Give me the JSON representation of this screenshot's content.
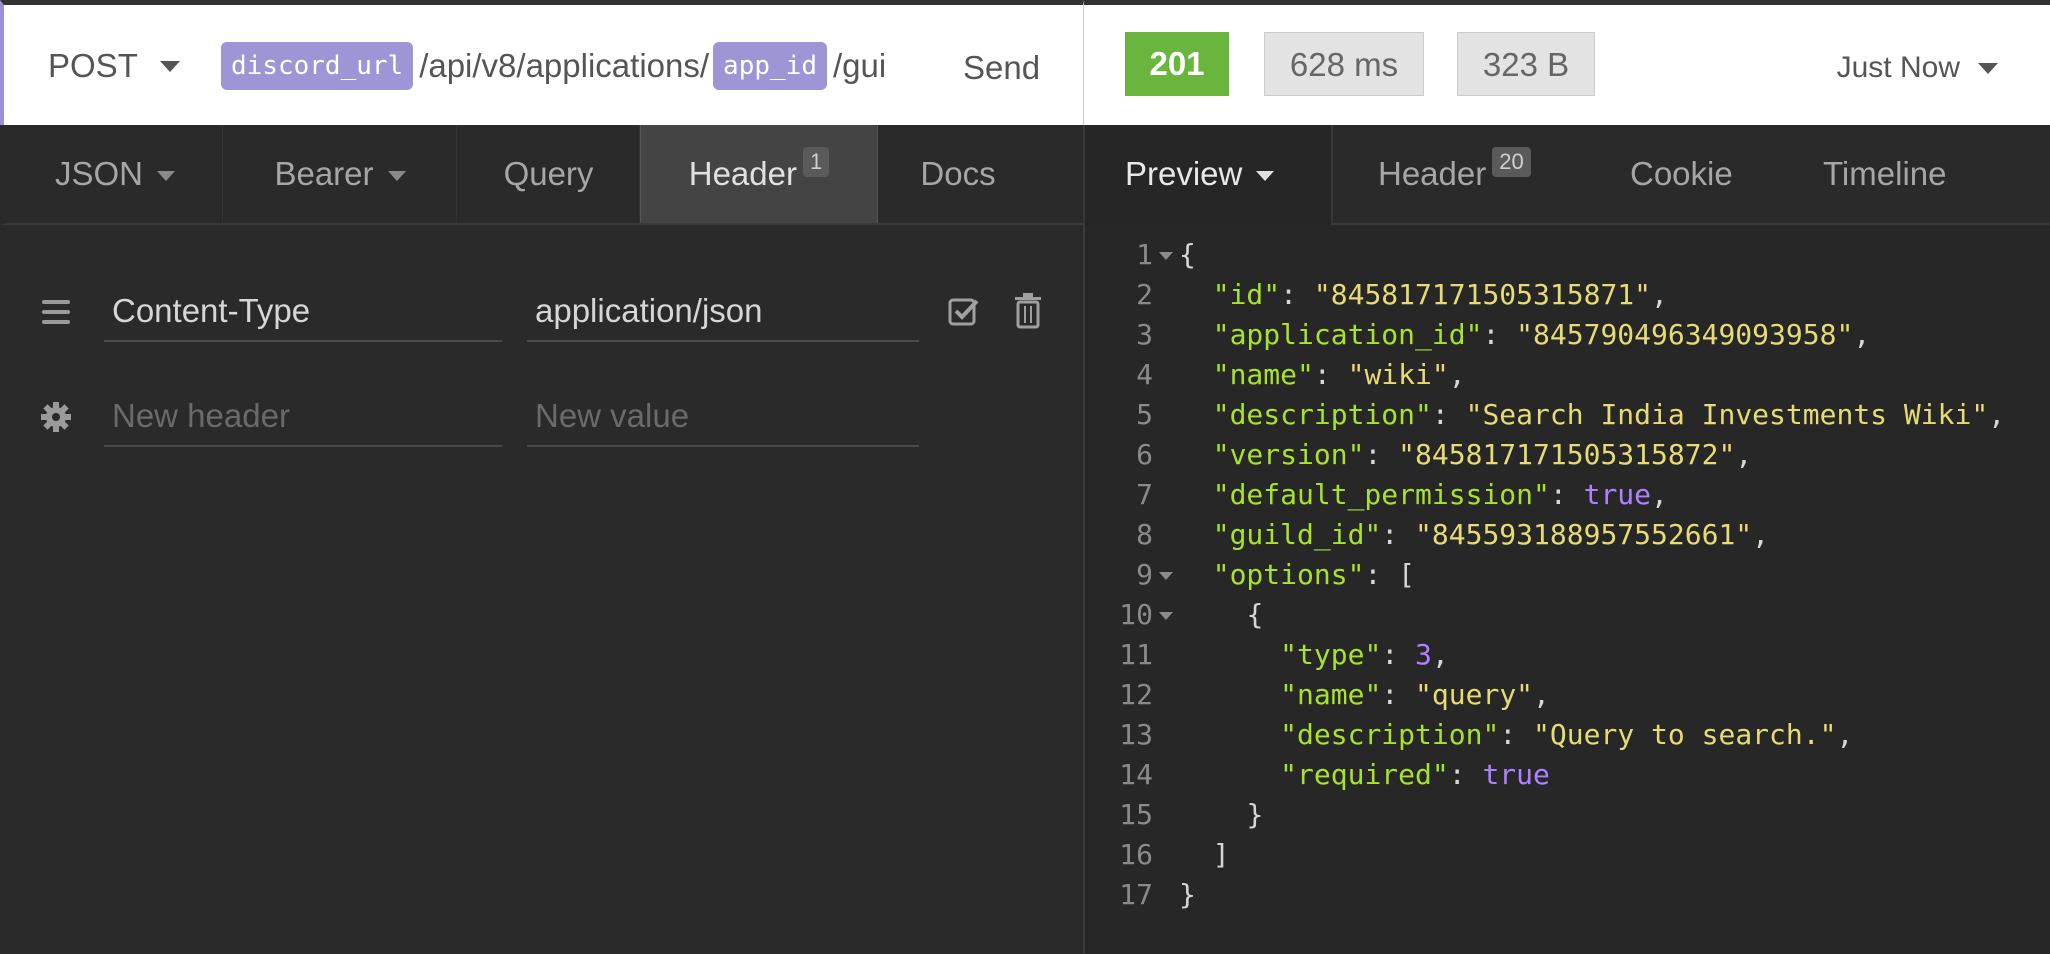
{
  "request": {
    "method": "POST",
    "url_var_1": "discord_url",
    "url_seg_1": "/api/v8/applications/",
    "url_var_2": "app_id",
    "url_seg_2": "/gui",
    "send_label": "Send"
  },
  "response_status": {
    "code": "201",
    "time": "628 ms",
    "size": "323 B",
    "when": "Just Now",
    "colors": {
      "success": "#6ab53d",
      "var_tag": "#9e95d6"
    }
  },
  "request_tabs": {
    "body": "JSON",
    "auth": "Bearer",
    "query": "Query",
    "header": "Header",
    "header_count": "1",
    "docs": "Docs"
  },
  "response_tabs": {
    "preview": "Preview",
    "header": "Header",
    "header_count": "20",
    "cookie": "Cookie",
    "timeline": "Timeline"
  },
  "headers": [
    {
      "name": "Content-Type",
      "value": "application/json"
    }
  ],
  "new_header": {
    "name_placeholder": "New header",
    "value_placeholder": "New value"
  },
  "response_body": [
    {
      "num": "1",
      "fold": true,
      "indent": 0,
      "tokens": [
        [
          "p",
          "{"
        ]
      ]
    },
    {
      "num": "2",
      "fold": false,
      "indent": 1,
      "tokens": [
        [
          "k",
          "\"id\""
        ],
        [
          "p",
          ": "
        ],
        [
          "s",
          "\"845817171505315871\""
        ],
        [
          "p",
          ","
        ]
      ]
    },
    {
      "num": "3",
      "fold": false,
      "indent": 1,
      "tokens": [
        [
          "k",
          "\"application_id\""
        ],
        [
          "p",
          ": "
        ],
        [
          "s",
          "\"845790496349093958\""
        ],
        [
          "p",
          ","
        ]
      ]
    },
    {
      "num": "4",
      "fold": false,
      "indent": 1,
      "tokens": [
        [
          "k",
          "\"name\""
        ],
        [
          "p",
          ": "
        ],
        [
          "s",
          "\"wiki\""
        ],
        [
          "p",
          ","
        ]
      ]
    },
    {
      "num": "5",
      "fold": false,
      "indent": 1,
      "tokens": [
        [
          "k",
          "\"description\""
        ],
        [
          "p",
          ": "
        ],
        [
          "s",
          "\"Search India Investments Wiki\""
        ],
        [
          "p",
          ","
        ]
      ]
    },
    {
      "num": "6",
      "fold": false,
      "indent": 1,
      "tokens": [
        [
          "k",
          "\"version\""
        ],
        [
          "p",
          ": "
        ],
        [
          "s",
          "\"845817171505315872\""
        ],
        [
          "p",
          ","
        ]
      ]
    },
    {
      "num": "7",
      "fold": false,
      "indent": 1,
      "tokens": [
        [
          "k",
          "\"default_permission\""
        ],
        [
          "p",
          ": "
        ],
        [
          "n",
          "true"
        ],
        [
          "p",
          ","
        ]
      ]
    },
    {
      "num": "8",
      "fold": false,
      "indent": 1,
      "tokens": [
        [
          "k",
          "\"guild_id\""
        ],
        [
          "p",
          ": "
        ],
        [
          "s",
          "\"845593188957552661\""
        ],
        [
          "p",
          ","
        ]
      ]
    },
    {
      "num": "9",
      "fold": true,
      "indent": 1,
      "tokens": [
        [
          "k",
          "\"options\""
        ],
        [
          "p",
          ": ["
        ]
      ]
    },
    {
      "num": "10",
      "fold": true,
      "indent": 2,
      "tokens": [
        [
          "p",
          "{"
        ]
      ]
    },
    {
      "num": "11",
      "fold": false,
      "indent": 3,
      "tokens": [
        [
          "k",
          "\"type\""
        ],
        [
          "p",
          ": "
        ],
        [
          "n",
          "3"
        ],
        [
          "p",
          ","
        ]
      ]
    },
    {
      "num": "12",
      "fold": false,
      "indent": 3,
      "tokens": [
        [
          "k",
          "\"name\""
        ],
        [
          "p",
          ": "
        ],
        [
          "s",
          "\"query\""
        ],
        [
          "p",
          ","
        ]
      ]
    },
    {
      "num": "13",
      "fold": false,
      "indent": 3,
      "tokens": [
        [
          "k",
          "\"description\""
        ],
        [
          "p",
          ": "
        ],
        [
          "s",
          "\"Query to search.\""
        ],
        [
          "p",
          ","
        ]
      ]
    },
    {
      "num": "14",
      "fold": false,
      "indent": 3,
      "tokens": [
        [
          "k",
          "\"required\""
        ],
        [
          "p",
          ": "
        ],
        [
          "n",
          "true"
        ]
      ]
    },
    {
      "num": "15",
      "fold": false,
      "indent": 2,
      "tokens": [
        [
          "p",
          "}"
        ]
      ]
    },
    {
      "num": "16",
      "fold": false,
      "indent": 1,
      "tokens": [
        [
          "p",
          "]"
        ]
      ]
    },
    {
      "num": "17",
      "fold": false,
      "indent": 0,
      "tokens": [
        [
          "p",
          "}"
        ]
      ]
    }
  ]
}
